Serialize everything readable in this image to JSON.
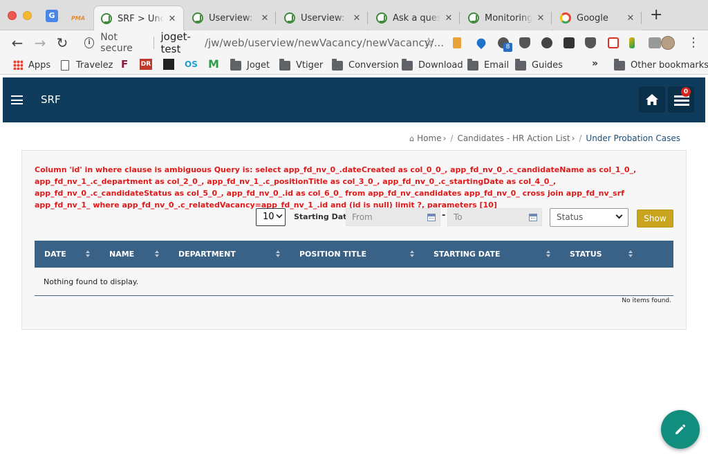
{
  "browser": {
    "tabs": [
      {
        "title": "SRF > Under Probation Cases",
        "active": true
      },
      {
        "title": "Userview: SRF",
        "active": false
      },
      {
        "title": "Userview: SRF",
        "active": false
      },
      {
        "title": "Ask a question",
        "active": false
      },
      {
        "title": "Monitoring App",
        "active": false
      },
      {
        "title": "Google",
        "active": false
      }
    ],
    "pinned": {
      "pma_label": "PMA",
      "translate_label": "G"
    },
    "address": {
      "security": "Not secure",
      "host": "joget-test",
      "path": "/jw/web/userview/newVacancy/newVacancy/..."
    },
    "extension_badge": "8",
    "bookmarks": [
      {
        "label": "Apps",
        "icon": "apps-grid-icon"
      },
      {
        "label": "Travelez",
        "icon": "page-icon"
      },
      {
        "label": "Joget",
        "icon": "folder-icon"
      },
      {
        "label": "Vtiger",
        "icon": "folder-icon"
      },
      {
        "label": "Conversion",
        "icon": "folder-icon"
      },
      {
        "label": "Download",
        "icon": "folder-icon"
      },
      {
        "label": "Email",
        "icon": "folder-icon"
      },
      {
        "label": "Guides",
        "icon": "folder-icon"
      },
      {
        "label": "Other bookmarks",
        "icon": "folder-icon"
      }
    ],
    "small_bookmark_icons": [
      "F",
      "DR",
      "OS",
      "M"
    ],
    "overflow_label": "»"
  },
  "app": {
    "title": "SRF",
    "notification_count": "0",
    "breadcrumb": {
      "home": "Home",
      "parent": "Candidates - HR Action List",
      "current": "Under Probation Cases",
      "separator": "/"
    },
    "error_message": "Column 'id' in where clause is ambiguous Query is: select app_fd_nv_0_.dateCreated as col_0_0_, app_fd_nv_0_.c_candidateName as col_1_0_, app_fd_nv_1_.c_department as col_2_0_, app_fd_nv_1_.c_positionTitle as col_3_0_, app_fd_nv_0_.c_startingDate as col_4_0_, app_fd_nv_0_.c_candidateStatus as col_5_0_, app_fd_nv_0_.id as col_6_0_ from app_fd_nv_candidates app_fd_nv_0_ cross join app_fd_nv_srf app_fd_nv_1_ where app_fd_nv_0_.c_relatedVacancy=app_fd_nv_1_.id and (id is null) limit ?, parameters [10]",
    "filters": {
      "page_size": "10",
      "date_label": "Starting Date",
      "from_placeholder": "From",
      "range_separator": "-",
      "to_placeholder": "To",
      "status_placeholder": "Status",
      "show_label": "Show"
    },
    "table": {
      "columns": [
        "DATE",
        "NAME",
        "DEPARTMENT",
        "POSITION TITLE",
        "STARTING DATE",
        "STATUS"
      ],
      "empty_message": "Nothing found to display.",
      "footer": "No items found."
    }
  },
  "colors": {
    "header": "#0f3c5c",
    "table_header": "#3a6186",
    "error_text": "#e01919",
    "show_button": "#c9a51f",
    "fab": "#118e7e",
    "badge": "#d9261c"
  }
}
